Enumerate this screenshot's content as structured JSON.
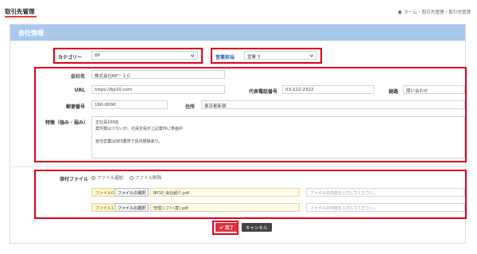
{
  "header": {
    "title": "取引先管理",
    "breadcrumb": [
      "ホーム",
      "取引先管理",
      "取引先管理"
    ],
    "breadcrumb_sep": "›"
  },
  "card": {
    "title": "会社情報"
  },
  "category": {
    "label": "カテゴリー",
    "value": "BP"
  },
  "sales": {
    "label": "営業担当",
    "value": "営業 3"
  },
  "company": {
    "name_label": "会社名",
    "name_value": "株式会社BP－１０",
    "url_label": "URL",
    "url_value": "https://bp10.com",
    "phone_label": "代表電話番号",
    "phone_value": "03-222-2322",
    "route_label": "経路",
    "route_value": "問い合わせ",
    "zip_label": "郵便番号",
    "zip_value": "160-0000",
    "address_label": "住所",
    "address_value": "東京都新宿",
    "notes_label": "特徴（強み・弱み）",
    "notes_lines": [
      "正社員100名",
      "案件数は少ないが、社員全員が上記案件に参画中",
      "",
      "担当営業はSES業界で長年経験あり。"
    ]
  },
  "attachments": {
    "label": "添付ファイル",
    "radio_add": "ファイル追加",
    "radio_delete": "ファイル削除",
    "files": [
      {
        "tag": "ファイル0",
        "button": "ファイルの選択",
        "name": "BP10_会社紹介.pdf",
        "placeholder": "ファイルの内容を入力してください。"
      },
      {
        "tag": "ファイル1",
        "button": "ファイルの選択",
        "name": "管理シフト(案).pdf",
        "placeholder": "ファイルの内容を入力してください。"
      }
    ]
  },
  "actions": {
    "done": "完了",
    "cancel": "キャンセル"
  },
  "colors": {
    "accent": "#e0452f",
    "header_bg": "#a9c9ec",
    "highlight": "#e2001a",
    "done": "#d9333f"
  }
}
